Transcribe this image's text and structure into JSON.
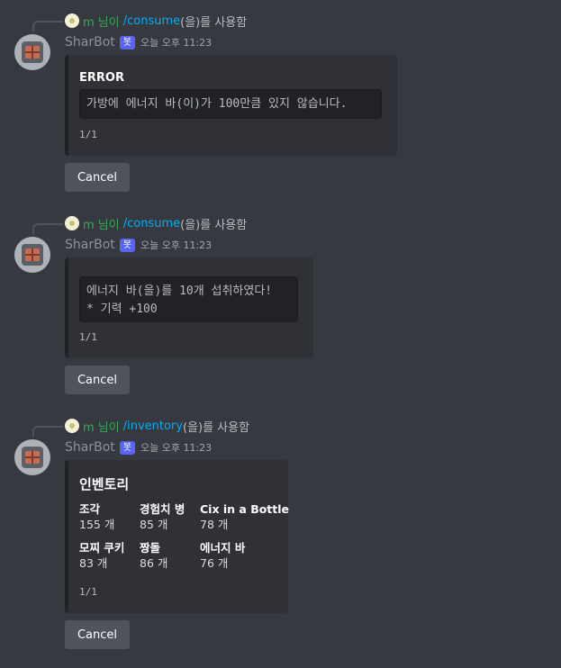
{
  "bot": {
    "name": "SharBot",
    "tag": "봇",
    "timestamp": "오늘 오후 11:23"
  },
  "reply_user": "m 님이",
  "reply_suffix": "(을)를 사용함",
  "messages": [
    {
      "command": "/consume",
      "embed": {
        "title": "ERROR",
        "code": "가방에 에너지 바(이)가 100만큼 있지 않습니다.",
        "footer": "1/1"
      },
      "button": "Cancel"
    },
    {
      "command": "/consume",
      "embed": {
        "code": "에너지 바(을)를 10개 섭취하였다!\n* 기력 +100",
        "footer": "1/1"
      },
      "button": "Cancel"
    },
    {
      "command": "/inventory",
      "embed": {
        "title": "인벤토리",
        "items": [
          {
            "name": "조각",
            "value": "155 개"
          },
          {
            "name": "경험치 병",
            "value": "85 개"
          },
          {
            "name": "Cix in a Bottle",
            "value": "78 개"
          },
          {
            "name": "모찌 쿠키",
            "value": "83 개"
          },
          {
            "name": "짱돌",
            "value": "86 개"
          },
          {
            "name": "에너지 바",
            "value": "76 개"
          }
        ],
        "footer": "1/1"
      },
      "button": "Cancel"
    }
  ]
}
